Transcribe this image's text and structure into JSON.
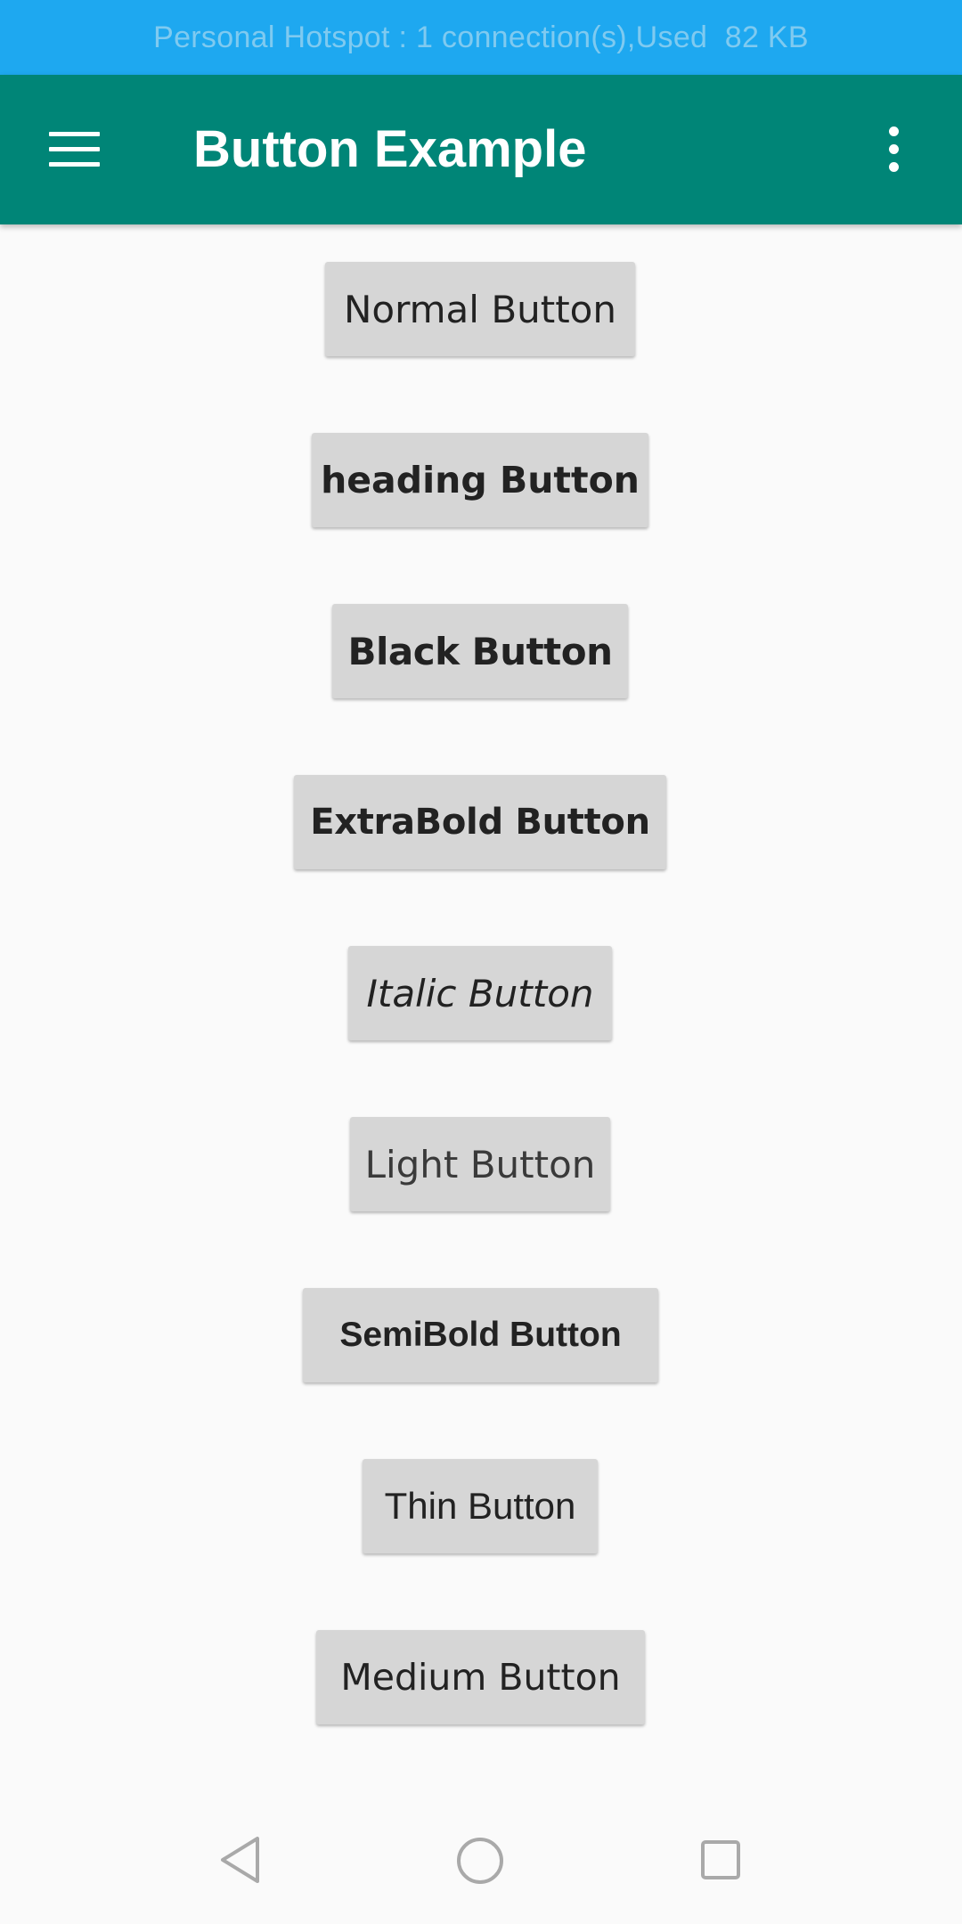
{
  "status_bar": {
    "text": "Personal Hotspot : 1 connection(s),Used  82 KB"
  },
  "app_bar": {
    "title": "Button Example",
    "menu_icon": "hamburger-menu-icon",
    "overflow_icon": "more-vertical-icon"
  },
  "buttons": {
    "normal": "Normal Button",
    "heading": "heading Button",
    "black": "Black Button",
    "extrabold": "ExtraBold Button",
    "italic": "Italic Button",
    "light": "Light Button",
    "semibold": "SemiBold Button",
    "thin": "Thin Button",
    "medium": "Medium Button"
  },
  "nav_bar": {
    "back_icon": "back-triangle-icon",
    "home_icon": "home-circle-icon",
    "recents_icon": "recents-square-icon"
  },
  "colors": {
    "status_bar": "#1ea8f0",
    "app_bar": "#008577",
    "background": "#fafafa",
    "button": "#d6d6d6"
  }
}
